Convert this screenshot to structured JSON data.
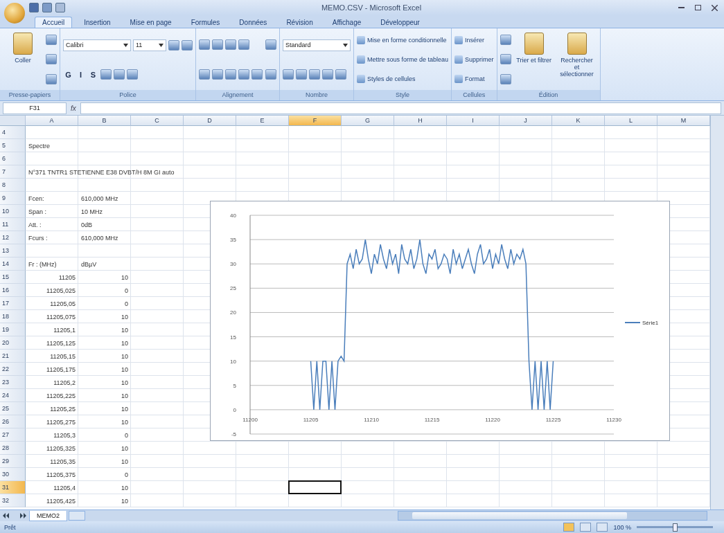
{
  "window": {
    "title": "MEMO.CSV - Microsoft Excel"
  },
  "ribbon_tabs": [
    {
      "label": "Accueil",
      "selected": true
    },
    {
      "label": "Insertion",
      "selected": false
    },
    {
      "label": "Mise en page",
      "selected": false
    },
    {
      "label": "Formules",
      "selected": false
    },
    {
      "label": "Données",
      "selected": false
    },
    {
      "label": "Révision",
      "selected": false
    },
    {
      "label": "Affichage",
      "selected": false
    },
    {
      "label": "Développeur",
      "selected": false
    }
  ],
  "ribbon_groups": [
    {
      "label": "Presse-papiers",
      "blocks": [
        {
          "kind": "large",
          "label": "Coller"
        },
        {
          "kind": "stack",
          "lines": [
            {
              "items": [
                {
                  "kind": "icon"
                }
              ]
            },
            {
              "items": [
                {
                  "kind": "icon"
                }
              ]
            },
            {
              "items": [
                {
                  "kind": "icon"
                }
              ]
            }
          ]
        }
      ]
    },
    {
      "label": "Police",
      "blocks": [
        {
          "kind": "stack",
          "lines": [
            {
              "items": [
                {
                  "kind": "combo",
                  "value": "Calibri"
                },
                {
                  "kind": "combo",
                  "value": "11"
                },
                {
                  "kind": "icon"
                },
                {
                  "kind": "icon"
                }
              ]
            },
            {
              "items": [
                {
                  "kind": "glyph",
                  "label": "G"
                },
                {
                  "kind": "glyph",
                  "label": "I"
                },
                {
                  "kind": "glyph",
                  "label": "S"
                },
                {
                  "kind": "icon"
                },
                {
                  "kind": "icon"
                },
                {
                  "kind": "icon"
                }
              ]
            }
          ]
        }
      ]
    },
    {
      "label": "Alignement",
      "blocks": [
        {
          "kind": "stack",
          "lines": [
            {
              "items": [
                {
                  "kind": "icon"
                },
                {
                  "kind": "icon"
                },
                {
                  "kind": "icon"
                },
                {
                  "kind": "icon"
                }
              ]
            },
            {
              "items": [
                {
                  "kind": "icon"
                },
                {
                  "kind": "icon"
                },
                {
                  "kind": "icon"
                },
                {
                  "kind": "icon"
                },
                {
                  "kind": "icon"
                }
              ]
            }
          ]
        },
        {
          "kind": "stack",
          "lines": [
            {
              "items": [
                {
                  "kind": "icon"
                }
              ]
            },
            {
              "items": [
                {
                  "kind": "icon"
                }
              ]
            }
          ]
        }
      ]
    },
    {
      "label": "Nombre",
      "blocks": [
        {
          "kind": "stack",
          "lines": [
            {
              "items": [
                {
                  "kind": "combo",
                  "value": "Standard"
                }
              ]
            },
            {
              "items": [
                {
                  "kind": "icon"
                },
                {
                  "kind": "icon"
                },
                {
                  "kind": "icon"
                },
                {
                  "kind": "icon"
                },
                {
                  "kind": "icon"
                }
              ]
            }
          ]
        }
      ]
    },
    {
      "label": "Style",
      "blocks": [
        {
          "kind": "stack",
          "lines": [
            {
              "items": [
                {
                  "kind": "small",
                  "label": "Mise en forme conditionnelle"
                }
              ]
            },
            {
              "items": [
                {
                  "kind": "small",
                  "label": "Mettre sous forme de tableau"
                }
              ]
            },
            {
              "items": [
                {
                  "kind": "small",
                  "label": "Styles de cellules"
                }
              ]
            }
          ]
        }
      ]
    },
    {
      "label": "Cellules",
      "blocks": [
        {
          "kind": "stack",
          "lines": [
            {
              "items": [
                {
                  "kind": "small",
                  "label": "Insérer"
                }
              ]
            },
            {
              "items": [
                {
                  "kind": "small",
                  "label": "Supprimer"
                }
              ]
            },
            {
              "items": [
                {
                  "kind": "small",
                  "label": "Format"
                }
              ]
            }
          ]
        }
      ]
    },
    {
      "label": "Édition",
      "blocks": [
        {
          "kind": "stack",
          "lines": [
            {
              "items": [
                {
                  "kind": "icon"
                }
              ]
            },
            {
              "items": [
                {
                  "kind": "icon"
                }
              ]
            },
            {
              "items": [
                {
                  "kind": "icon"
                }
              ]
            }
          ]
        },
        {
          "kind": "large",
          "label": "Trier et filtrer"
        },
        {
          "kind": "large",
          "label": "Rechercher et sélectionner"
        }
      ]
    }
  ],
  "formula_bar": {
    "name_box": "F31",
    "formula_label": "fx"
  },
  "sheet": {
    "columns": [
      {
        "label": "A",
        "selected": false
      },
      {
        "label": "B",
        "selected": false
      },
      {
        "label": "C",
        "selected": false
      },
      {
        "label": "D",
        "selected": false
      },
      {
        "label": "E",
        "selected": false
      },
      {
        "label": "F",
        "selected": true
      },
      {
        "label": "G",
        "selected": false
      },
      {
        "label": "H",
        "selected": false
      },
      {
        "label": "I",
        "selected": false
      },
      {
        "label": "J",
        "selected": false
      },
      {
        "label": "K",
        "selected": false
      },
      {
        "label": "L",
        "selected": false
      },
      {
        "label": "M",
        "selected": false
      }
    ],
    "rows": [
      {
        "label": "4",
        "selected": false
      },
      {
        "label": "5",
        "selected": false,
        "cells": [
          {
            "kind": "text",
            "text": "Spectre"
          }
        ]
      },
      {
        "label": "6",
        "selected": false
      },
      {
        "label": "7",
        "selected": false,
        "cells": [
          {
            "kind": "text",
            "text": "N°371 TNTR1 STETIENNE E38 DVBT/H 8M GI auto"
          }
        ]
      },
      {
        "label": "8",
        "selected": false
      },
      {
        "label": "9",
        "selected": false,
        "cells": [
          {
            "kind": "text",
            "text": "Fcen:"
          },
          {
            "kind": "text",
            "text": "610,000 MHz"
          }
        ]
      },
      {
        "label": "10",
        "selected": false,
        "cells": [
          {
            "kind": "text",
            "text": "Span :"
          },
          {
            "kind": "text",
            "text": "10 MHz"
          }
        ]
      },
      {
        "label": "11",
        "selected": false,
        "cells": [
          {
            "kind": "text",
            "text": "Att. :"
          },
          {
            "kind": "text",
            "text": "0dB"
          }
        ]
      },
      {
        "label": "12",
        "selected": false,
        "cells": [
          {
            "kind": "text",
            "text": "Fcurs :"
          },
          {
            "kind": "text",
            "text": "610,000 MHz"
          }
        ]
      },
      {
        "label": "13",
        "selected": false
      },
      {
        "label": "14",
        "selected": false,
        "cells": [
          {
            "kind": "text",
            "text": "Fr : (MHz)"
          },
          {
            "kind": "text",
            "text": "dBµV"
          }
        ]
      },
      {
        "label": "15",
        "selected": false,
        "cells": [
          {
            "kind": "number",
            "text": "11205"
          },
          {
            "kind": "number",
            "text": "10"
          }
        ]
      },
      {
        "label": "16",
        "selected": false,
        "cells": [
          {
            "kind": "number",
            "text": "11205,025"
          },
          {
            "kind": "number",
            "text": "0"
          }
        ]
      },
      {
        "label": "17",
        "selected": false,
        "cells": [
          {
            "kind": "number",
            "text": "11205,05"
          },
          {
            "kind": "number",
            "text": "0"
          }
        ]
      },
      {
        "label": "18",
        "selected": false,
        "cells": [
          {
            "kind": "number",
            "text": "11205,075"
          },
          {
            "kind": "number",
            "text": "10"
          }
        ]
      },
      {
        "label": "19",
        "selected": false,
        "cells": [
          {
            "kind": "number",
            "text": "11205,1"
          },
          {
            "kind": "number",
            "text": "10"
          }
        ]
      },
      {
        "label": "20",
        "selected": false,
        "cells": [
          {
            "kind": "number",
            "text": "11205,125"
          },
          {
            "kind": "number",
            "text": "10"
          }
        ]
      },
      {
        "label": "21",
        "selected": false,
        "cells": [
          {
            "kind": "number",
            "text": "11205,15"
          },
          {
            "kind": "number",
            "text": "10"
          }
        ]
      },
      {
        "label": "22",
        "selected": false,
        "cells": [
          {
            "kind": "number",
            "text": "11205,175"
          },
          {
            "kind": "number",
            "text": "10"
          }
        ]
      },
      {
        "label": "23",
        "selected": false,
        "cells": [
          {
            "kind": "number",
            "text": "11205,2"
          },
          {
            "kind": "number",
            "text": "10"
          }
        ]
      },
      {
        "label": "24",
        "selected": false,
        "cells": [
          {
            "kind": "number",
            "text": "11205,225"
          },
          {
            "kind": "number",
            "text": "10"
          }
        ]
      },
      {
        "label": "25",
        "selected": false,
        "cells": [
          {
            "kind": "number",
            "text": "11205,25"
          },
          {
            "kind": "number",
            "text": "10"
          }
        ]
      },
      {
        "label": "26",
        "selected": false,
        "cells": [
          {
            "kind": "number",
            "text": "11205,275"
          },
          {
            "kind": "number",
            "text": "10"
          }
        ]
      },
      {
        "label": "27",
        "selected": false,
        "cells": [
          {
            "kind": "number",
            "text": "11205,3"
          },
          {
            "kind": "number",
            "text": "0"
          }
        ]
      },
      {
        "label": "28",
        "selected": false,
        "cells": [
          {
            "kind": "number",
            "text": "11205,325"
          },
          {
            "kind": "number",
            "text": "10"
          }
        ]
      },
      {
        "label": "29",
        "selected": false,
        "cells": [
          {
            "kind": "number",
            "text": "11205,35"
          },
          {
            "kind": "number",
            "text": "10"
          }
        ]
      },
      {
        "label": "30",
        "selected": false,
        "cells": [
          {
            "kind": "number",
            "text": "11205,375"
          },
          {
            "kind": "number",
            "text": "0"
          }
        ]
      },
      {
        "label": "31",
        "selected": true,
        "cells": [
          {
            "kind": "number",
            "text": "11205,4"
          },
          {
            "kind": "number",
            "text": "10"
          }
        ]
      },
      {
        "label": "32",
        "selected": false,
        "cells": [
          {
            "kind": "number",
            "text": "11205,425"
          },
          {
            "kind": "number",
            "text": "10"
          }
        ]
      }
    ]
  },
  "chart": {
    "chart_data": {
      "type": "line",
      "grid": true,
      "xlim": [
        11200,
        11230
      ],
      "ylim": [
        -5,
        40
      ],
      "xticks": [
        11200,
        11205,
        11210,
        11215,
        11220,
        11225,
        11230
      ],
      "yticks": [
        -5,
        0,
        5,
        10,
        15,
        20,
        25,
        30,
        35,
        40
      ],
      "x": [
        11205,
        11205.25,
        11205.5,
        11205.75,
        11206,
        11206.25,
        11206.5,
        11206.75,
        11207,
        11207.25,
        11207.5,
        11207.75,
        11208,
        11208.25,
        11208.5,
        11208.75,
        11209,
        11209.25,
        11209.5,
        11209.75,
        11210,
        11210.25,
        11210.5,
        11210.75,
        11211,
        11211.25,
        11211.5,
        11211.75,
        11212,
        11212.25,
        11212.5,
        11212.75,
        11213,
        11213.25,
        11213.5,
        11213.75,
        11214,
        11214.25,
        11214.5,
        11214.75,
        11215,
        11215.25,
        11215.5,
        11215.75,
        11216,
        11216.25,
        11216.5,
        11216.75,
        11217,
        11217.25,
        11217.5,
        11217.75,
        11218,
        11218.25,
        11218.5,
        11218.75,
        11219,
        11219.25,
        11219.5,
        11219.75,
        11220,
        11220.25,
        11220.5,
        11220.75,
        11221,
        11221.25,
        11221.5,
        11221.75,
        11222,
        11222.25,
        11222.5,
        11222.75,
        11223,
        11223.25,
        11223.5,
        11223.75,
        11224,
        11224.25,
        11224.5,
        11224.75,
        11225
      ],
      "series": [
        {
          "name": "Série1",
          "color": "#4a7ebb",
          "values": [
            10,
            0,
            10,
            0,
            10,
            10,
            0,
            10,
            0,
            10,
            11,
            10,
            30,
            32,
            29,
            33,
            30,
            31,
            35,
            31,
            28,
            32,
            30,
            34,
            31,
            29,
            33,
            30,
            32,
            28,
            34,
            31,
            30,
            33,
            29,
            31,
            35,
            30,
            28,
            32,
            31,
            33,
            29,
            30,
            32,
            31,
            28,
            33,
            30,
            32,
            29,
            31,
            33,
            30,
            28,
            32,
            34,
            30,
            31,
            33,
            29,
            32,
            30,
            34,
            31,
            29,
            33,
            30,
            32,
            31,
            33,
            30,
            10,
            0,
            10,
            0,
            10,
            0,
            10,
            0,
            10
          ]
        }
      ]
    }
  },
  "sheet_tabs": [
    {
      "label": "MEMO2",
      "selected": true
    }
  ],
  "status_bar": {
    "status": "Prêt",
    "zoom": "100 %",
    "zoom_slider": {
      "level": 0.5
    }
  }
}
